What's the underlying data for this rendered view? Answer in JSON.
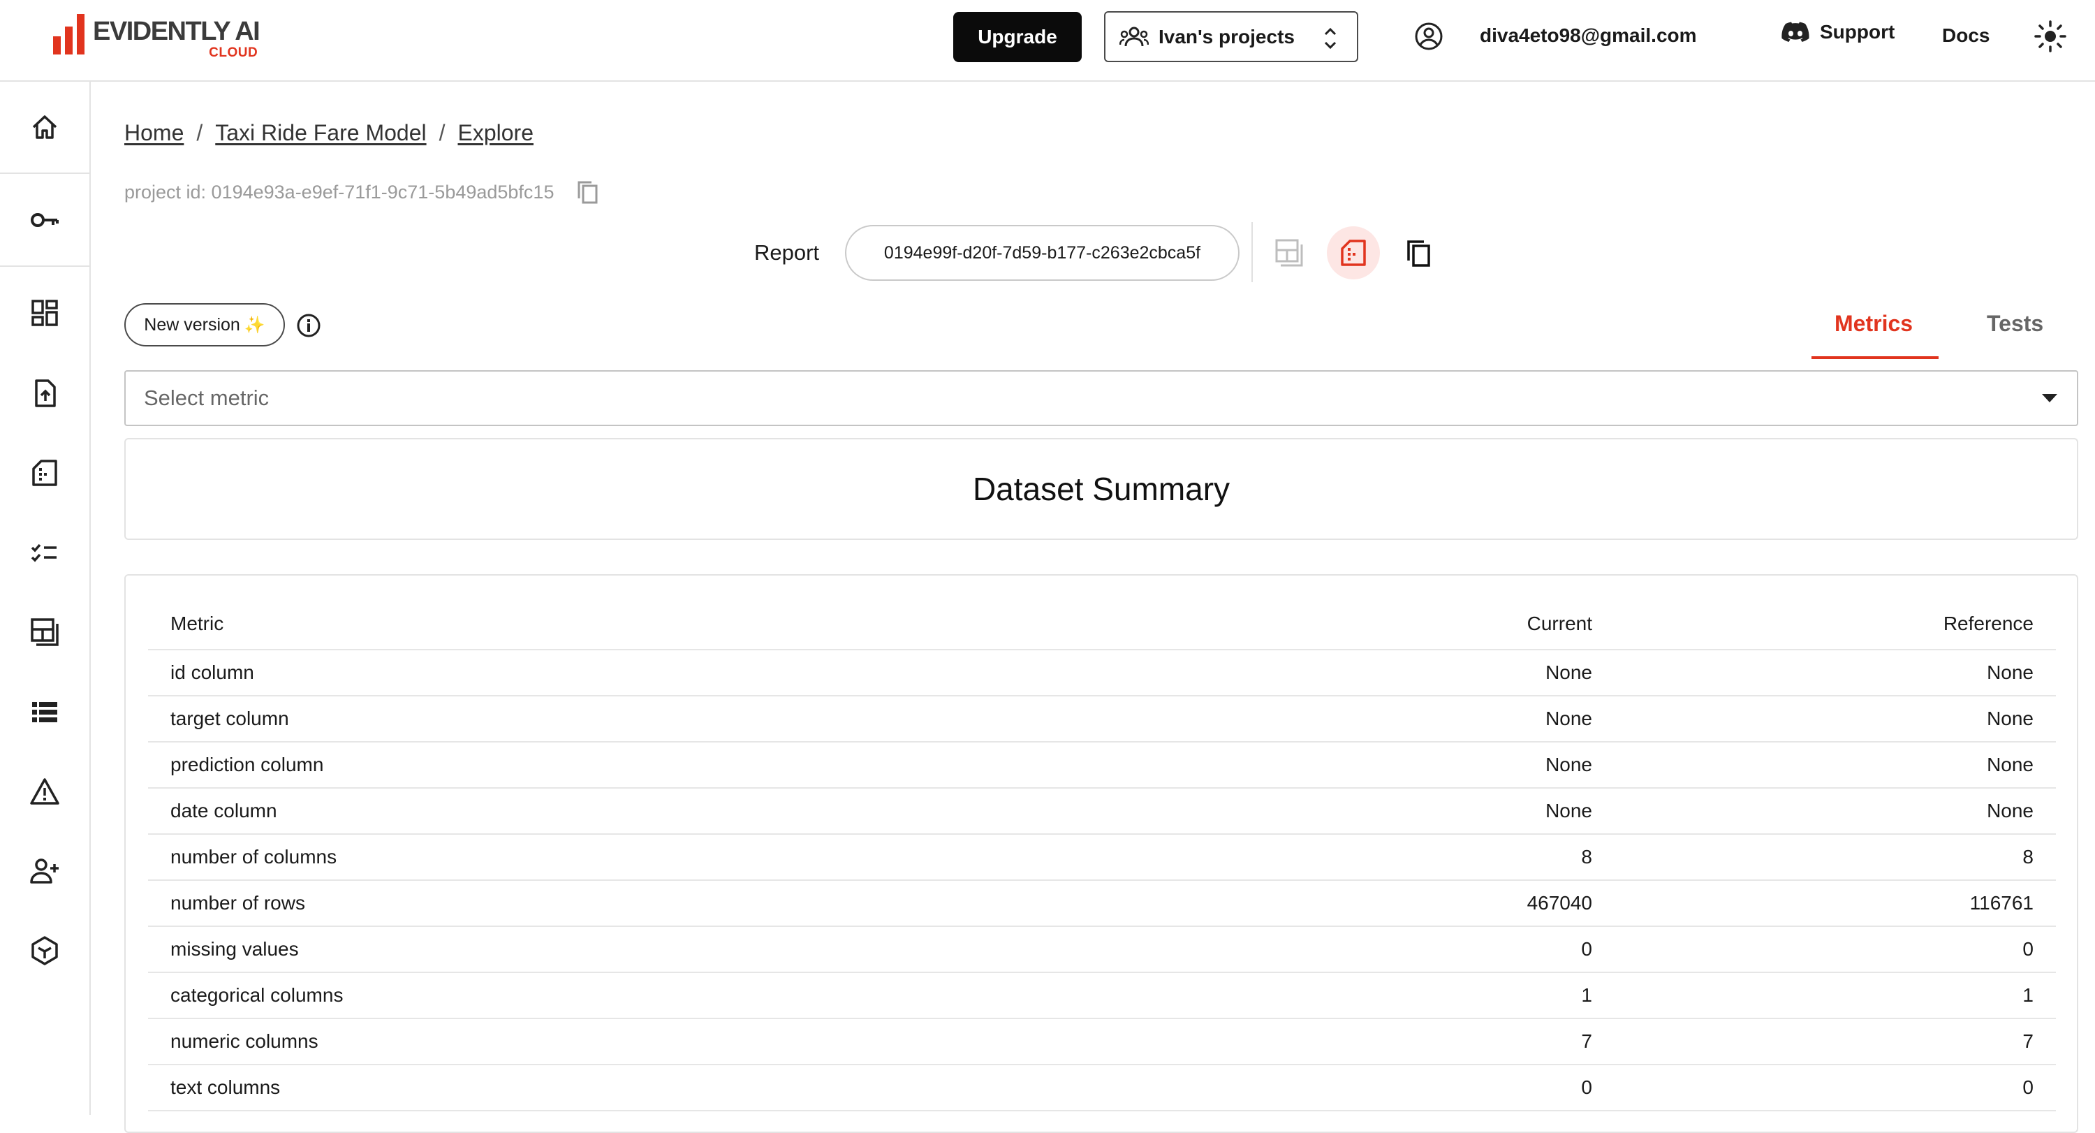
{
  "brand": {
    "name": "EVIDENTLY AI",
    "sub": "CLOUD",
    "accent": "#e1341e"
  },
  "header": {
    "upgrade_label": "Upgrade",
    "project_selector": "Ivan's projects",
    "user_email": "diva4eto98@gmail.com",
    "support_label": "Support",
    "docs_label": "Docs"
  },
  "sidebar": {
    "items": [
      {
        "icon": "home-icon"
      },
      {
        "icon": "key-icon"
      },
      {
        "icon": "dashboard-icon"
      },
      {
        "icon": "upload-icon"
      },
      {
        "icon": "report-icon"
      },
      {
        "icon": "tests-icon"
      },
      {
        "icon": "panels-icon"
      },
      {
        "icon": "list-icon"
      },
      {
        "icon": "alert-icon"
      },
      {
        "icon": "add-user-icon"
      },
      {
        "icon": "cube-icon"
      }
    ]
  },
  "breadcrumb": {
    "home": "Home",
    "project": "Taxi Ride Fare Model",
    "page": "Explore",
    "sep": "/"
  },
  "project_id": "project id: 0194e93a-e9ef-71f1-9c71-5b49ad5bfc15",
  "report": {
    "label": "Report",
    "id": "0194e99f-d20f-7d59-b177-c263e2cbca5f"
  },
  "new_version_label": "New version",
  "new_version_sparkle": "✨",
  "tabs": {
    "metrics": "Metrics",
    "tests": "Tests",
    "active": "Metrics"
  },
  "select_metric_placeholder": "Select metric",
  "summary_title": "Dataset Summary",
  "table": {
    "headers": [
      "Metric",
      "Current",
      "Reference"
    ],
    "rows": [
      [
        "id column",
        "None",
        "None"
      ],
      [
        "target column",
        "None",
        "None"
      ],
      [
        "prediction column",
        "None",
        "None"
      ],
      [
        "date column",
        "None",
        "None"
      ],
      [
        "number of columns",
        "8",
        "8"
      ],
      [
        "number of rows",
        "467040",
        "116761"
      ],
      [
        "missing values",
        "0",
        "0"
      ],
      [
        "categorical columns",
        "1",
        "1"
      ],
      [
        "numeric columns",
        "7",
        "7"
      ],
      [
        "text columns",
        "0",
        "0"
      ]
    ]
  }
}
